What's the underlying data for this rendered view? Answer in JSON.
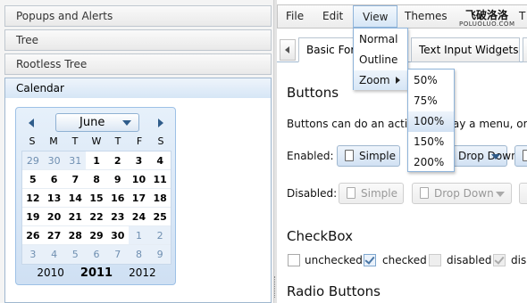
{
  "accordion": {
    "items": [
      {
        "label": "Popups and Alerts"
      },
      {
        "label": "Tree"
      },
      {
        "label": "Rootless Tree"
      },
      {
        "label": "Calendar"
      }
    ]
  },
  "calendar": {
    "month": "June",
    "weekdays": [
      "S",
      "M",
      "T",
      "W",
      "T",
      "F",
      "S"
    ],
    "weeks": [
      [
        "29",
        "30",
        "31",
        "1",
        "2",
        "3",
        "4"
      ],
      [
        "5",
        "6",
        "7",
        "8",
        "9",
        "10",
        "11"
      ],
      [
        "12",
        "13",
        "14",
        "15",
        "16",
        "17",
        "18"
      ],
      [
        "19",
        "20",
        "21",
        "22",
        "23",
        "24",
        "25"
      ],
      [
        "26",
        "27",
        "28",
        "29",
        "30",
        "1",
        "2"
      ],
      [
        "3",
        "4",
        "5",
        "6",
        "7",
        "8",
        "9"
      ]
    ],
    "years": {
      "prev": "2010",
      "current": "2011",
      "next": "2012"
    }
  },
  "menubar": {
    "file": "File",
    "edit": "Edit",
    "view": "View",
    "themes": "Themes",
    "t": "T"
  },
  "logo": {
    "text": "飞破洛洛",
    "sub": "POLUOLUO.COM"
  },
  "view_menu": {
    "normal": "Normal",
    "outline": "Outline",
    "zoom": "Zoom"
  },
  "zoom_menu": {
    "items": [
      "50%",
      "75%",
      "100%",
      "150%",
      "200%"
    ],
    "selected": "100%"
  },
  "tabs": {
    "basic": "Basic Form Widgets",
    "text": "Text Input Widgets"
  },
  "content": {
    "buttons_heading": "Buttons",
    "buttons_desc": "Buttons can do an action, display a menu, or both",
    "enabled_label": "Enabled:",
    "disabled_label": "Disabled:",
    "simple": "Simple",
    "drop_down": "Drop Down",
    "checkbox_heading": "CheckBox",
    "unchecked": "unchecked",
    "checked": "checked",
    "disabled": "disabled",
    "disabled_checked": "disabled",
    "radio_heading": "Radio Buttons"
  }
}
